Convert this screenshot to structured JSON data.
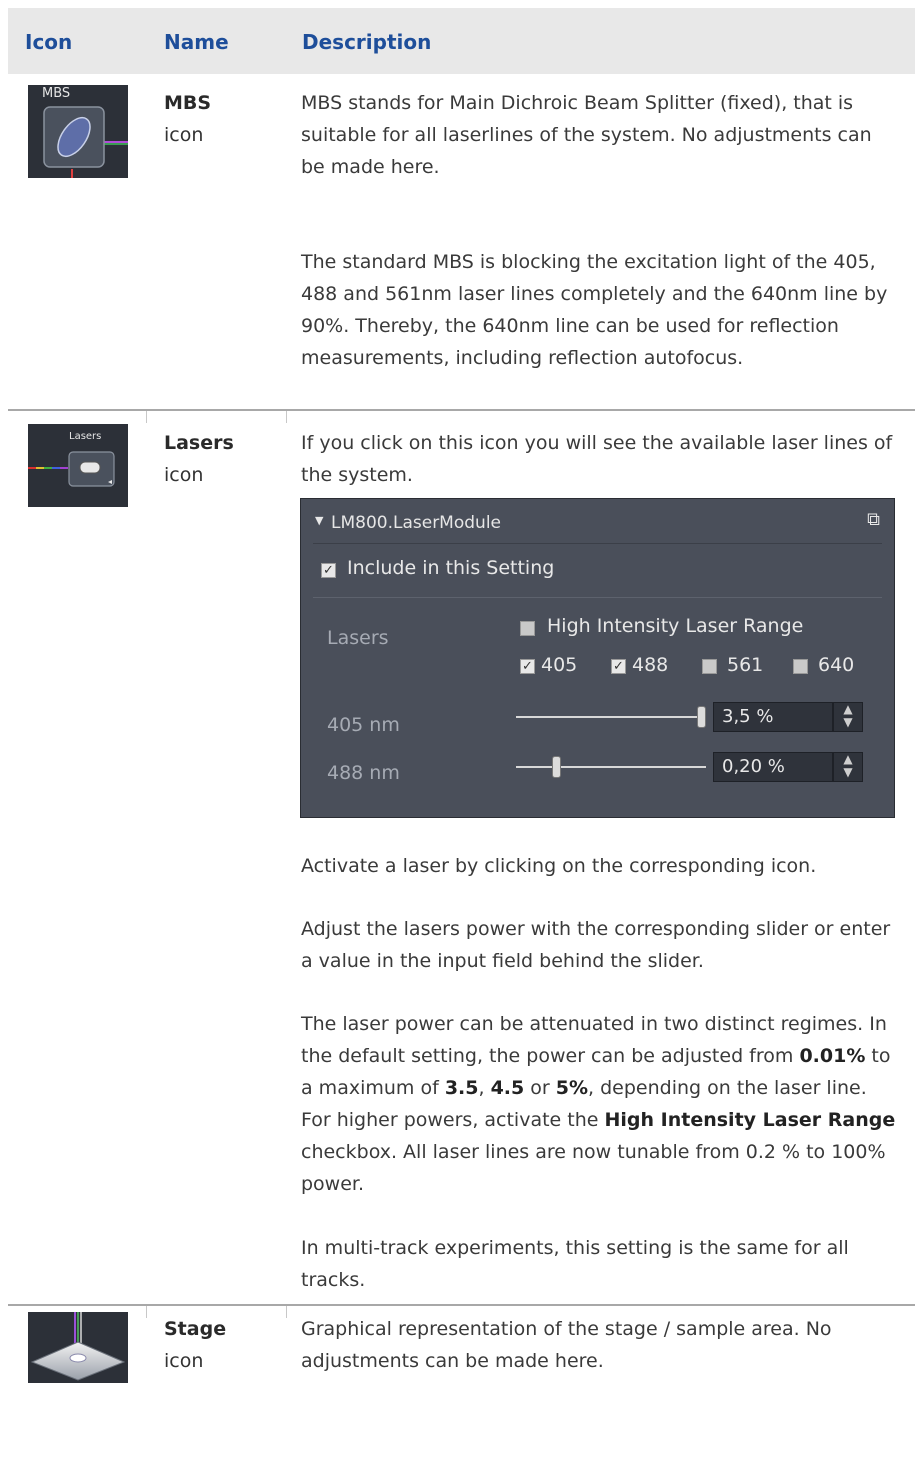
{
  "header": {
    "icon": "Icon",
    "name": "Name",
    "description": "Description"
  },
  "rows": [
    {
      "icon_label": "MBS",
      "name": "MBS",
      "name_sub": "icon",
      "paragraphs": [
        "MBS stands for Main Dichroic Beam Splitter (fixed), that is suitable for all laserlines of the system. No adjustments can be made here.",
        "The standard MBS is blocking the excitation light of the 405, 488 and 561nm laser lines completely and the 640nm line by 90%. Thereby, the 640nm line can be used for reflection measurements, including reflection autofocus."
      ]
    },
    {
      "icon_label": "Lasers",
      "name": "Lasers",
      "name_sub": "icon",
      "intro": "If you click on this icon you will see the available laser lines of the system.",
      "panel": {
        "title": "LM800.LaserModule",
        "include": "Include in this Setting",
        "lasers_label": "Lasers",
        "high_intensity": "High Intensity Laser Range",
        "lines": [
          "405",
          "488",
          "561",
          "640"
        ],
        "line_checked": [
          true,
          true,
          false,
          false
        ],
        "slider1_label": "405 nm",
        "slider1_value": "3,5 %",
        "slider1_level": 1.0,
        "slider2_label": "488 nm",
        "slider2_value": "0,20 %",
        "slider2_level": 0.2
      },
      "p_activate": "Activate a laser by clicking on the corresponding icon.",
      "p_adjust": "Adjust the lasers power with the corresponding slider or enter a value in the input field behind the slider.",
      "p3": {
        "a": "The laser power can be attenuated in two distinct regimes. In the default setting, the power can be adjusted from ",
        "b1": "0.01%",
        "c": " to a maximum of ",
        "b2": "3.5",
        "d": ", ",
        "b3": "4.5",
        "e": " or ",
        "b4": "5%",
        "f": ", depending on the laser line. For higher powers, activate the ",
        "b5": "High Intensity Laser Range",
        "g": " checkbox. All laser lines are now tunable from 0.2 % to 100% power."
      },
      "p_multi": "In multi-track experiments, this setting is the same for all tracks."
    },
    {
      "name": "Stage",
      "name_sub": "icon",
      "paragraphs": [
        "Graphical representation of the stage / sample area. No adjustments can be made here."
      ]
    }
  ],
  "colors": {
    "heading_blue": "#1e4e9a",
    "header_bg": "#e8e8e8",
    "panel_bg": "#4a4f5a"
  }
}
